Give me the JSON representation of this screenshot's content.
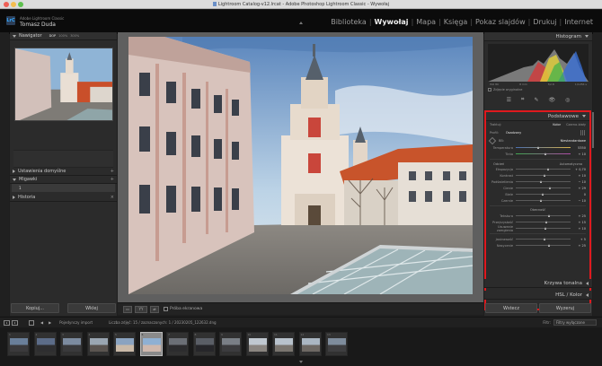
{
  "window": {
    "title": "Lightroom Catalog-v12.lrcat - Adobe Photoshop Lightroom Classic - Wywołaj"
  },
  "identity": {
    "app": "Adobe Lightroom Classic",
    "user": "Tomasz Duda",
    "logo": "LrC"
  },
  "modules": [
    {
      "label": "Biblioteka",
      "active": false
    },
    {
      "label": "Wywołaj",
      "active": true
    },
    {
      "label": "Mapa",
      "active": false
    },
    {
      "label": "Księga",
      "active": false
    },
    {
      "label": "Pokaz slajdów",
      "active": false
    },
    {
      "label": "Drukuj",
      "active": false
    },
    {
      "label": "Internet",
      "active": false
    }
  ],
  "left": {
    "navigator": {
      "title": "Nawigator",
      "zoom_options": [
        "DOP",
        "100%",
        "300%"
      ],
      "zoom_selected": "DOP"
    },
    "presets": {
      "title": "Ustawienia domyślne",
      "add": "+"
    },
    "snapshots": {
      "title": "Migawki",
      "add": "+",
      "item": "1"
    },
    "history": {
      "title": "Historia",
      "clear": "×"
    },
    "copy_button": "Kopiuj...",
    "paste_button": "Wklej"
  },
  "toolbar": {
    "soft_proof_label": "Próba ekranowa"
  },
  "right": {
    "histogram": {
      "title": "Histogram",
      "info_left": "ISO 80",
      "info_mid1": "8 mm",
      "info_mid2": "f/2.8",
      "info_right": "1/1256 s",
      "original_label": "Zdjęcie oryginalne"
    },
    "basic": {
      "title": "Podstawowe",
      "treatment_label": "Traktuj:",
      "treatment_options": [
        "Kolor",
        "Czarno-biały"
      ],
      "treatment_selected": "Kolor",
      "profile_label": "Profil:",
      "profile_value": "Osadzony",
      "wb_label": "BB:",
      "wb_value": "Niestandardowe",
      "sliders_wb": [
        {
          "label": "Temperatura",
          "value": "5350",
          "pos": 0.42
        },
        {
          "label": "Tinta",
          "value": "+ 10",
          "pos": 0.55
        }
      ],
      "tone_label": "Odcień",
      "auto_label": "Automatyczna",
      "sliders_tone": [
        {
          "label": "Ekspozycja",
          "value": "+ 0,70",
          "pos": 0.6
        },
        {
          "label": "Kontrast",
          "value": "+ 10",
          "pos": 0.54
        },
        {
          "label": "Podświetlenia",
          "value": "− 10",
          "pos": 0.46
        },
        {
          "label": "Cienie",
          "value": "+ 29",
          "pos": 0.63
        },
        {
          "label": "Biele",
          "value": "0",
          "pos": 0.5
        },
        {
          "label": "Czernie",
          "value": "− 10",
          "pos": 0.46
        }
      ],
      "presence_label": "Obecność",
      "sliders_presence": [
        {
          "label": "Tekstura",
          "value": "+ 25",
          "pos": 0.62
        },
        {
          "label": "Przejrzystość",
          "value": "+ 15",
          "pos": 0.57
        },
        {
          "label": "Usuwanie zamglenia",
          "value": "+ 10",
          "pos": 0.55
        }
      ],
      "sliders_color": [
        {
          "label": "Jaskrawość",
          "value": "+ 5",
          "pos": 0.53
        },
        {
          "label": "Nasycenie",
          "value": "+ 25",
          "pos": 0.62
        }
      ]
    },
    "tone_curve": {
      "title": "Krzywa tonalna"
    },
    "hsl": {
      "title": "HSL / Kolor"
    },
    "previous_button": "Wstecz",
    "reset_button": "Wyzeruj"
  },
  "filmstrip": {
    "source": "Pojedynczy import",
    "count": "Liczba zdjęć: 15 / zaznaczonych: 1 / 20230205_122632.dng",
    "filter_label": "Filtr:",
    "filter_value": "Filtry wyłączone",
    "thumbs": [
      "1",
      "2",
      "3",
      "4",
      "5",
      "6",
      "7",
      "8",
      "9",
      "10",
      "11",
      "12",
      "13"
    ],
    "selected_index": 5
  },
  "colors": {
    "accent_red": "#e0191e",
    "panel_bg": "#2b2b2b"
  }
}
